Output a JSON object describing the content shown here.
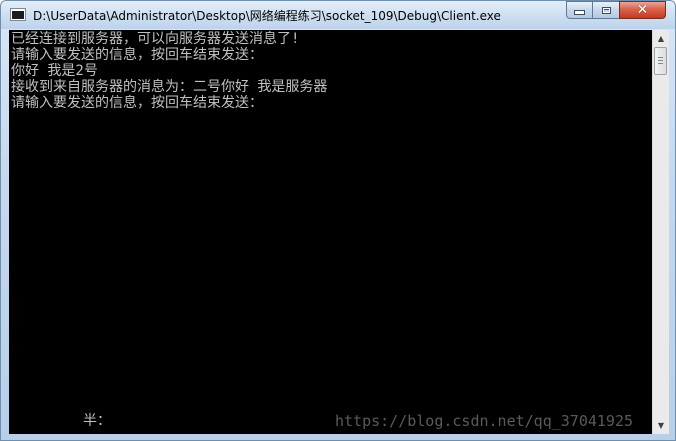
{
  "window": {
    "title": "D:\\UserData\\Administrator\\Desktop\\网络编程练习\\socket_109\\Debug\\Client.exe",
    "icon": "console-window-icon"
  },
  "controls": {
    "minimize": "minimize-icon",
    "maximize": "maximize-icon",
    "close": "close-icon",
    "close_glyph": "✕",
    "close_color": "#c43a20"
  },
  "console": {
    "background": "#000000",
    "text_color": "#c0c0c0",
    "lines": [
      "已经连接到服务器，可以向服务器发送消息了!",
      "请输入要发送的信息，按回车结束发送：",
      "你好 我是2号",
      "接收到来自服务器的消息为：二号你好 我是服务器",
      "请输入要发送的信息，按回车结束发送："
    ],
    "ime_status": "半：",
    "watermark": "https://blog.csdn.net/qq_37041925"
  },
  "scrollbar": {
    "up_glyph": "▲",
    "down_glyph": "▼"
  }
}
